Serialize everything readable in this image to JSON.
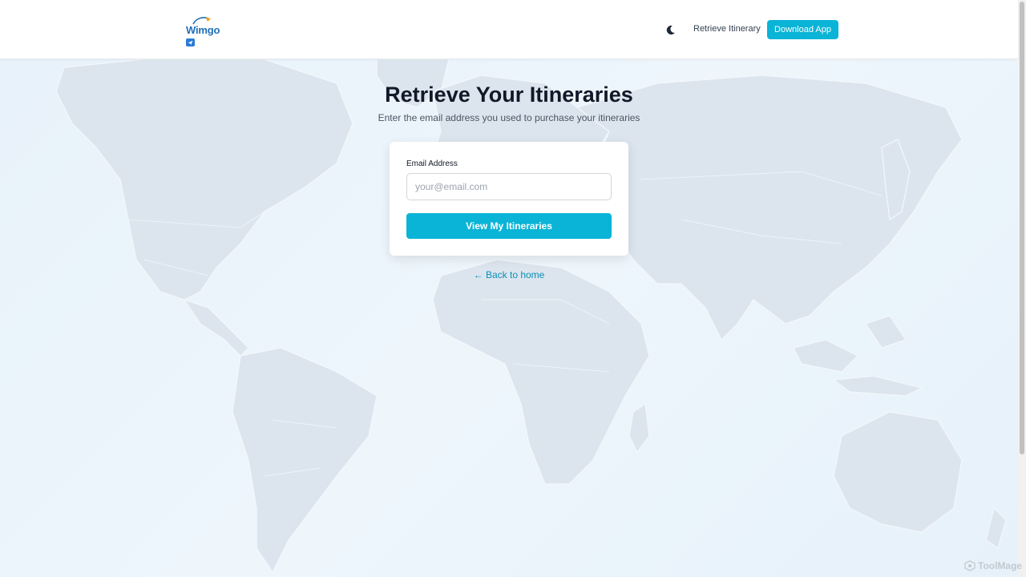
{
  "header": {
    "logo_text": "Wimgo",
    "nav_retrieve": "Retrieve Itinerary",
    "download_label": "Download App"
  },
  "main": {
    "title": "Retrieve Your Itineraries",
    "subtitle": "Enter the email address you used to purchase your itineraries",
    "form": {
      "email_label": "Email Address",
      "email_value": "",
      "email_placeholder": "your@email.com",
      "submit_label": "View My Itineraries"
    },
    "back_link": "← Back to home"
  },
  "watermark": "ToolMage",
  "colors": {
    "accent": "#0ab4d6",
    "link": "#0a8fb5",
    "map_land": "#dde6ee"
  },
  "icons": {
    "theme_toggle": "moon-icon",
    "logo_badge": "paper-plane-icon"
  }
}
